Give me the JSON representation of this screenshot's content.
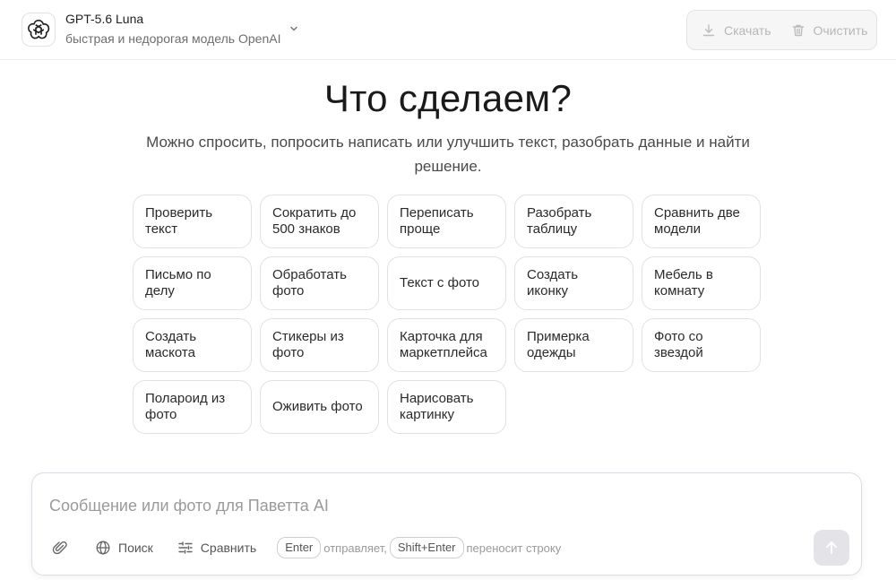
{
  "header": {
    "model_name": "GPT-5.6 Luna",
    "model_desc": "быстрая и недорогая модель OpenAI",
    "download_label": "Скачать",
    "clear_label": "Очистить"
  },
  "hero": {
    "title": "Что сделаем?",
    "subtitle": "Можно спросить, попросить написать или улучшить текст, разобрать данные и найти решение."
  },
  "suggestions": [
    "Проверить текст",
    "Сократить до 500 знаков",
    "Переписать проще",
    "Разобрать таблицу",
    "Сравнить две модели",
    "Письмо по делу",
    "Обработать фото",
    "Текст с фото",
    "Создать иконку",
    "Мебель в комнату",
    "Создать маскота",
    "Стикеры из фото",
    "Карточка для маркетплейса",
    "Примерка одежды",
    "Фото со звездой",
    "Полароид из фото",
    "Оживить фото",
    "Нарисовать картинку"
  ],
  "composer": {
    "placeholder": "Сообщение или фото для Паветта AI",
    "search_label": "Поиск",
    "compare_label": "Сравнить",
    "enter_key": "Enter",
    "enter_hint": "отправляет,",
    "shift_enter_key": "Shift+Enter",
    "shift_enter_hint": "переносит строку"
  },
  "icons": {
    "logo": "openai-logo-icon",
    "chevron": "chevron-down-icon",
    "download": "download-icon",
    "clear": "trash-icon",
    "attach": "paperclip-icon",
    "search": "globe-icon",
    "compare": "sliders-icon",
    "send": "arrow-up-icon"
  }
}
